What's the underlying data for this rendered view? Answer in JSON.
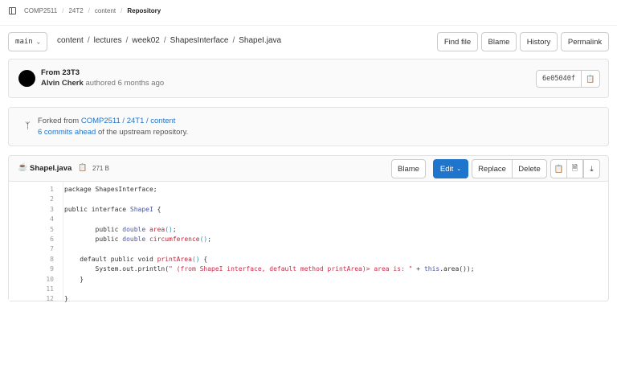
{
  "breadcrumb": [
    "COMP2511",
    "24T2",
    "content",
    "Repository"
  ],
  "branch": {
    "label": "main",
    "icon": "chevron-down-icon"
  },
  "path": [
    "content",
    "lectures",
    "week02",
    "ShapesInterface",
    "ShapeI.java"
  ],
  "actions": {
    "find_file": "Find file",
    "blame": "Blame",
    "history": "History",
    "permalink": "Permalink"
  },
  "commit": {
    "title": "From 23T3",
    "author": "Alvin Cherk",
    "authored": "authored 6 months ago",
    "sha": "6e05040f"
  },
  "fork": {
    "prefix": "Forked from",
    "source": "COMP2511 / 24T1 / content",
    "ahead": "6 commits ahead",
    "suffix": "of the upstream repository."
  },
  "file": {
    "name": "ShapeI.java",
    "size": "271 B",
    "blame": "Blame",
    "edit": "Edit",
    "replace": "Replace",
    "delete": "Delete"
  },
  "code": [
    [
      [
        "package ShapesInterface;",
        "k"
      ]
    ],
    [],
    [
      [
        "public interface ",
        "k"
      ],
      [
        "ShapeI",
        "ty"
      ],
      [
        " {",
        "k"
      ]
    ],
    [],
    [
      [
        "        public ",
        "k"
      ],
      [
        "double ",
        "ty"
      ],
      [
        "area",
        "fn"
      ],
      [
        "()",
        "p"
      ],
      [
        ";",
        "k"
      ]
    ],
    [
      [
        "        public ",
        "k"
      ],
      [
        "double ",
        "ty"
      ],
      [
        "circumference",
        "fn"
      ],
      [
        "()",
        "p"
      ],
      [
        ";",
        "k"
      ]
    ],
    [],
    [
      [
        "    default public void ",
        "k"
      ],
      [
        "printArea",
        "fn"
      ],
      [
        "()",
        "p"
      ],
      [
        " {",
        "k"
      ]
    ],
    [
      [
        "        System.out.println(",
        "k"
      ],
      [
        "\" (from ShapeI interface, default method printArea)> area is: \"",
        "s"
      ],
      [
        " + ",
        "k"
      ],
      [
        "this",
        "ty"
      ],
      [
        ".area());",
        "k"
      ]
    ],
    [
      [
        "    }",
        "k"
      ]
    ],
    [],
    [
      [
        "}",
        "k"
      ]
    ]
  ]
}
